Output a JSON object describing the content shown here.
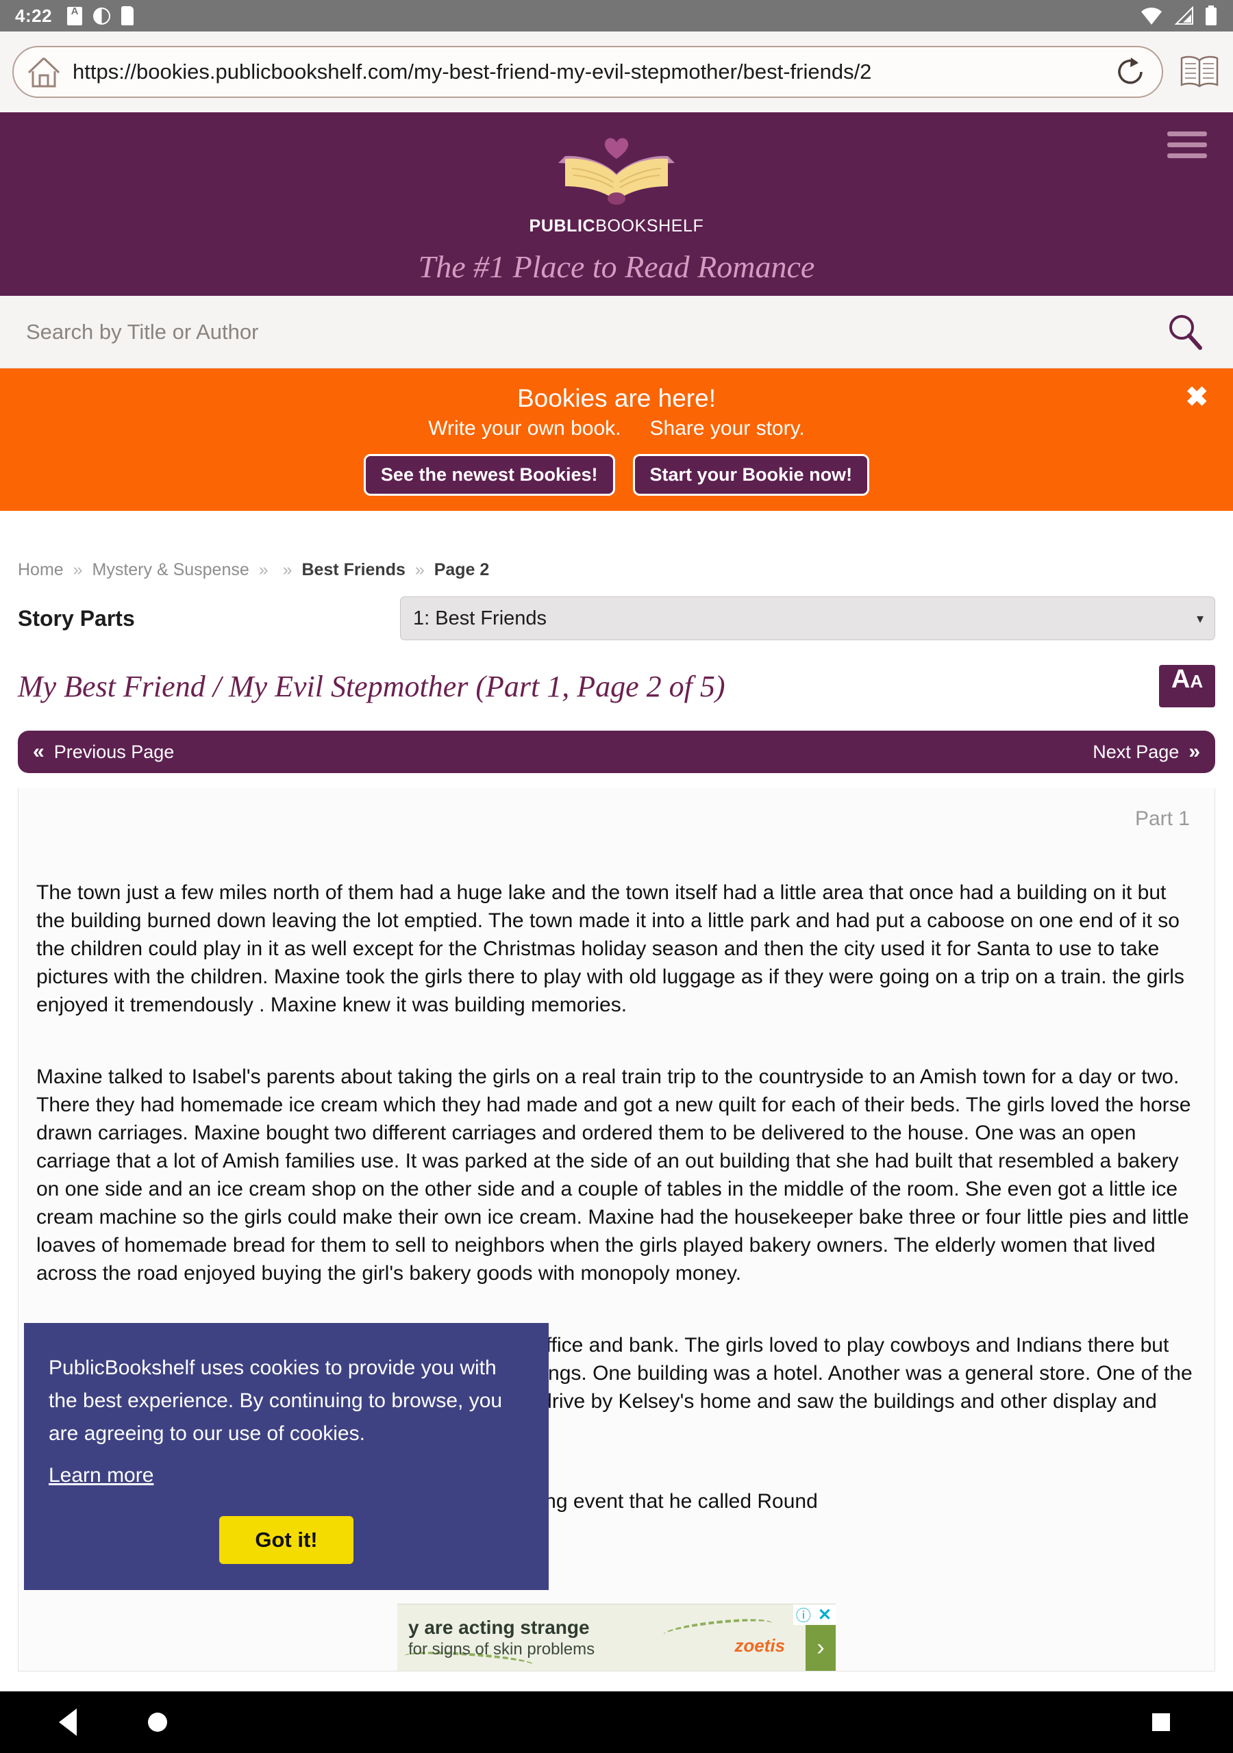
{
  "status_bar": {
    "clock": "4:22",
    "icons": [
      "font-size-indicator-icon",
      "screen-rotation-icon",
      "sdcard-icon",
      "wifi-icon",
      "cellular-signal-icon",
      "battery-icon"
    ]
  },
  "browser": {
    "url": "https://bookies.publicbookshelf.com/my-best-friend-my-evil-stepmother/best-friends/2",
    "home_icon": "home-icon",
    "reload_icon": "reload-icon",
    "reader_icon": "open-book-icon"
  },
  "site_header": {
    "logo_word_bold": "PUBLIC",
    "logo_word_light": "BOOKSHELF",
    "tagline": "The #1 Place to Read Romance",
    "menu_icon": "hamburger-menu-icon",
    "bg_color": "#5d2150",
    "tagline_color": "#d79bc3"
  },
  "search": {
    "placeholder": "Search by Title or Author",
    "value": "",
    "icon": "search-icon"
  },
  "promo": {
    "title": "Bookies are here!",
    "sub_left": "Write your own book.",
    "sub_right": "Share your story.",
    "button_newest": "See the newest Bookies!",
    "button_start": "Start your Bookie now!",
    "close_label": "✖",
    "bg_color": "#fb6504"
  },
  "breadcrumb": {
    "home": "Home",
    "category": "Mystery & Suspense",
    "book": "Best Friends",
    "page": "Page 2",
    "separator": "»"
  },
  "story_parts": {
    "label": "Story Parts",
    "selected": "1: Best Friends",
    "caret": "▾"
  },
  "story": {
    "title": "My Best Friend / My Evil Stepmother (Part 1, Page 2 of 5)",
    "font_button_big": "A",
    "font_button_small": "A",
    "part_label": "Part 1",
    "prev_page": "Previous Page",
    "next_page": "Next Page",
    "prev_chevron": "«",
    "next_chevron": "»",
    "paragraphs": [
      "The town just a few miles north of them had a huge lake and the town itself had a little area that once had a building on it but the building burned down leaving the lot emptied. The town made it into a little park and had put a caboose on one end of it so the children could play in it as well except for the Christmas holiday season and then the city used it for Santa to use to take pictures with the children. Maxine took the girls there to play with old luggage as if they were going on a trip on a train. the girls enjoyed it tremendously . Maxine knew it was building memories.",
      "Maxine talked to Isabel's parents about taking the girls on a real train trip to the countryside to an Amish town for a day or two. There they had homemade ice cream which they had made and got a new quilt for each of their beds. The girls loved the horse drawn carriages. Maxine bought two different carriages and ordered them to be delivered to the house. One was an open carriage that a lot of Amish families use. It was parked at the side of an out building that she had built that resembled a bakery on one side and an ice cream shop on the other side and a couple of tables in the middle of the room. She even got a little ice cream machine so the girls could make their own ice cream. Maxine had the housekeeper bake three or four little pies and little loaves of homemade bread for them to sell to neighbors when the girls played bakery owners. The elderly women that lived across the road enjoyed buying the girl's bakery goods with monopoly money.",
      "There was a small western town set up by the sheriff's office and bank. The girls loved to play cowboys and Indians there but they did not play with it as much as some of the other things. One building was a hotel. Another was a general store. One of the members of the town's board of aldermen happened to drive by Kelsey's home and saw the buildings and other display and drove into the driveway to have a closer look.",
      "Maxine talked to the alderman and suggested a week long event that he called Round"
    ]
  },
  "cookie_banner": {
    "text": "PublicBookshelf uses cookies to provide you with the best experience. By continuing to browse, you are agreeing to our use of cookies.",
    "link": "Learn more",
    "button": "Got it!",
    "bg_color": "#3f4282",
    "button_color": "#f5dc00"
  },
  "ad": {
    "line1": "y are acting strange",
    "line2": "for signs of skin problems",
    "brand": "zoetis",
    "info_icon": "ad-info-icon",
    "close_icon": "ad-close-icon",
    "next_icon": "ad-next-arrow-icon"
  },
  "nav_bar": {
    "back": "back-icon",
    "home": "home-circle-icon",
    "recents": "recents-square-icon"
  }
}
